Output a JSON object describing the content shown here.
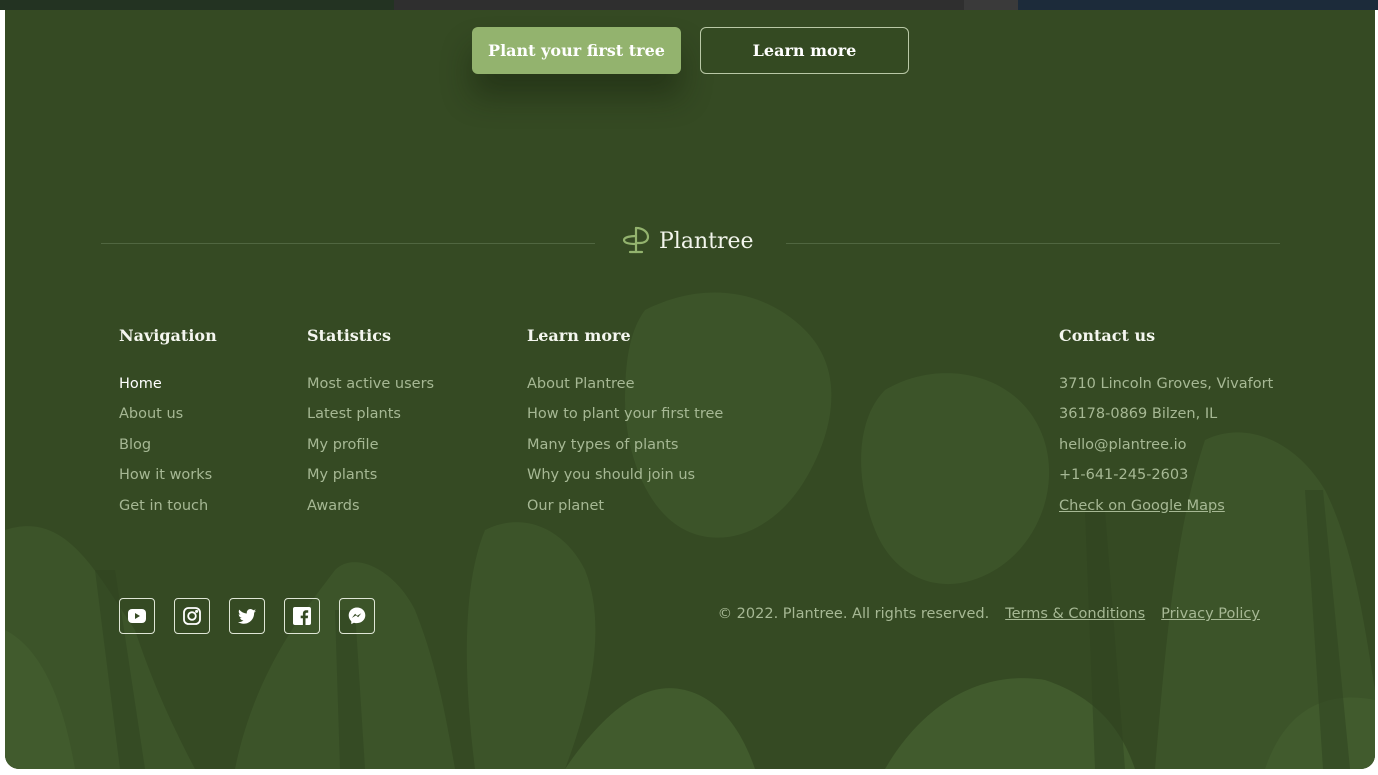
{
  "cta": {
    "primary_label": "Plant your first tree",
    "secondary_label": "Learn more"
  },
  "brand": {
    "name": "Plantree",
    "icon": "tree-logo-icon"
  },
  "columns": {
    "navigation": {
      "title": "Navigation",
      "items": [
        "Home",
        "About us",
        "Blog",
        "How it works",
        "Get in touch"
      ]
    },
    "statistics": {
      "title": "Statistics",
      "items": [
        "Most active users",
        "Latest plants",
        "My profile",
        "My plants",
        "Awards"
      ]
    },
    "learn_more": {
      "title": "Learn more",
      "items": [
        "About Plantree",
        "How to plant your first tree",
        "Many types of plants",
        "Why you should join us",
        "Our planet"
      ]
    },
    "contact": {
      "title": "Contact us",
      "items": [
        "3710 Lincoln Groves, Vivafort",
        "36178-0869 Bilzen, IL",
        "hello@plantree.io",
        "+1-641-245-2603",
        "Check on Google Maps"
      ]
    }
  },
  "social": [
    "youtube-icon",
    "instagram-icon",
    "twitter-icon",
    "facebook-icon",
    "messenger-icon"
  ],
  "legal": {
    "copyright": "© 2022. Plantree. All rights reserved.",
    "terms": "Terms & Conditions",
    "privacy": "Privacy Policy"
  },
  "colors": {
    "background": "#354a23",
    "accent": "#93b36e",
    "muted_text": "#a6b894"
  }
}
